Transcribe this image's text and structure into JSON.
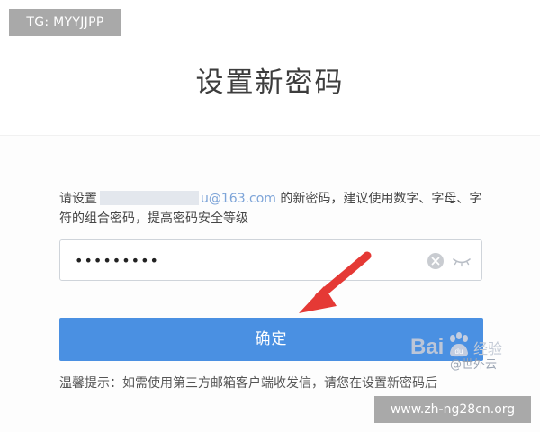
{
  "overlay": {
    "tg_label": "TG: MYYJJPP",
    "site_label": "www.zh-ng28cn.org"
  },
  "dialog": {
    "title": "设置新密码",
    "instruction_prefix": "请设置",
    "email_domain": "u@163.com",
    "instruction_suffix": " 的新密码，建议使用数字、字母、字符的组合密码，提高密码安全等级",
    "password_value": "•••••••••",
    "confirm_label": "确定",
    "tip": "温馨提示：如需使用第三方邮箱客户端收发信，请您在设置新密码后"
  },
  "watermark": {
    "brand": "Bai",
    "paw_text": "du",
    "suffix": "经验",
    "author": "@世外云"
  },
  "colors": {
    "button": "#4a90e2",
    "arrow": "#e53935",
    "email_link": "#7da4d8"
  }
}
